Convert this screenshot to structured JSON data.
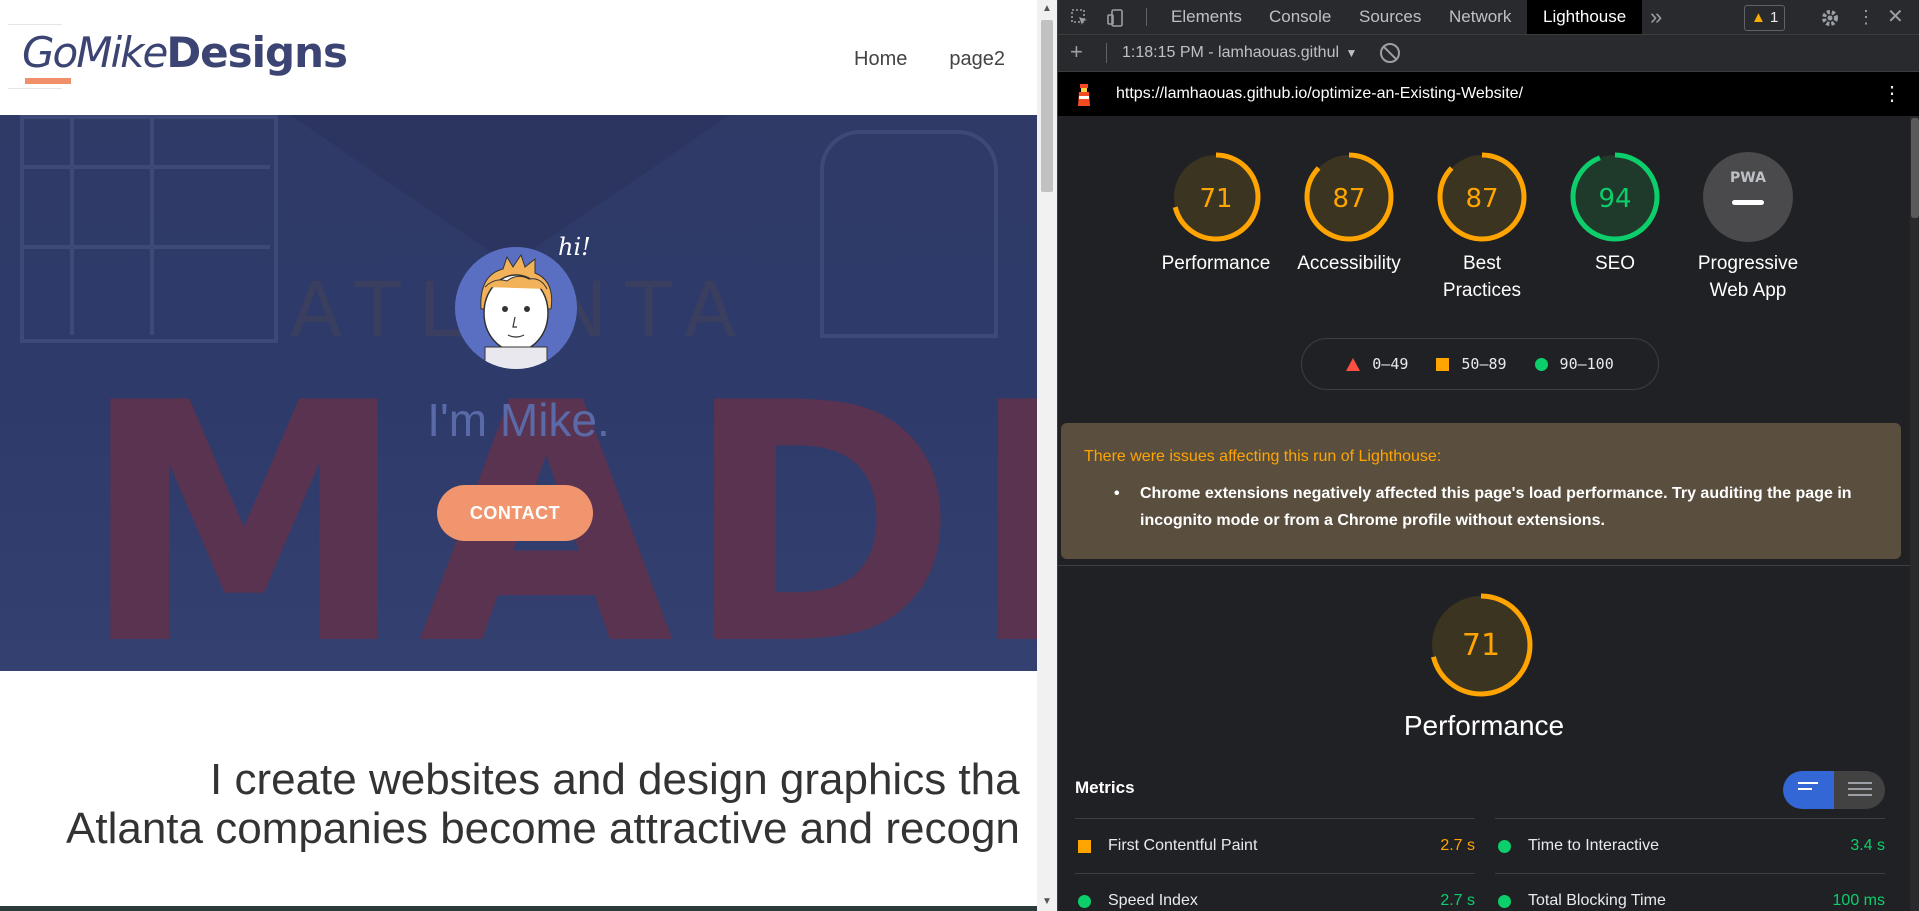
{
  "site": {
    "logo_part1": "GoMike",
    "logo_part2": "Designs",
    "nav": [
      {
        "label": "Home"
      },
      {
        "label": "page2"
      }
    ],
    "hero": {
      "bg_word_top": "ATLANTA",
      "bg_word_big": "MADE",
      "greeting_bubble": "hi!",
      "title": "I'm Mike.",
      "contact_label": "CONTACT"
    },
    "intro_line1": "I create websites and design graphics tha",
    "intro_line2": "Atlanta companies become attractive and recogn"
  },
  "devtools": {
    "tabs": [
      {
        "label": "Elements"
      },
      {
        "label": "Console"
      },
      {
        "label": "Sources"
      },
      {
        "label": "Network"
      },
      {
        "label": "Lighthouse"
      }
    ],
    "more_tabs": "»",
    "warning_count": "1",
    "toolbar": {
      "add": "+",
      "report_select": "1:18:15 PM - lamhaouas.githul",
      "dropdown": "▼"
    },
    "url": "https://lamhaouas.github.io/optimize-an-Existing-Website/",
    "menu": "⋮",
    "categories": [
      {
        "label": "Performance",
        "score": "71",
        "value": 71,
        "status": "average"
      },
      {
        "label": "Accessibility",
        "score": "87",
        "value": 87,
        "status": "average"
      },
      {
        "label": "Best Practices",
        "score": "87",
        "value": 87,
        "status": "average"
      },
      {
        "label": "SEO",
        "score": "94",
        "value": 94,
        "status": "pass"
      },
      {
        "label": "Progressive Web App",
        "score": "PWA",
        "status": "na"
      }
    ],
    "legend": [
      {
        "label": "0–49",
        "type": "fail"
      },
      {
        "label": "50–89",
        "type": "average"
      },
      {
        "label": "90–100",
        "type": "pass"
      }
    ],
    "issues": {
      "title": "There were issues affecting this run of Lighthouse:",
      "item": "Chrome extensions negatively affected this page's load performance. Try auditing the page in incognito mode or from a Chrome profile without extensions."
    },
    "performance": {
      "score": "71",
      "value": 71,
      "title": "Performance"
    },
    "metrics_header": "Metrics",
    "metrics": [
      {
        "name": "First Contentful Paint",
        "value": "2.7 s",
        "status": "average"
      },
      {
        "name": "Time to Interactive",
        "value": "3.4 s",
        "status": "pass"
      },
      {
        "name": "Speed Index",
        "value": "2.7 s",
        "status": "pass"
      },
      {
        "name": "Total Blocking Time",
        "value": "100 ms",
        "status": "pass"
      }
    ],
    "colors": {
      "average": "#ffa400",
      "pass": "#0cce6b",
      "fail": "#ff4e42",
      "accent": "#3367d6"
    }
  }
}
